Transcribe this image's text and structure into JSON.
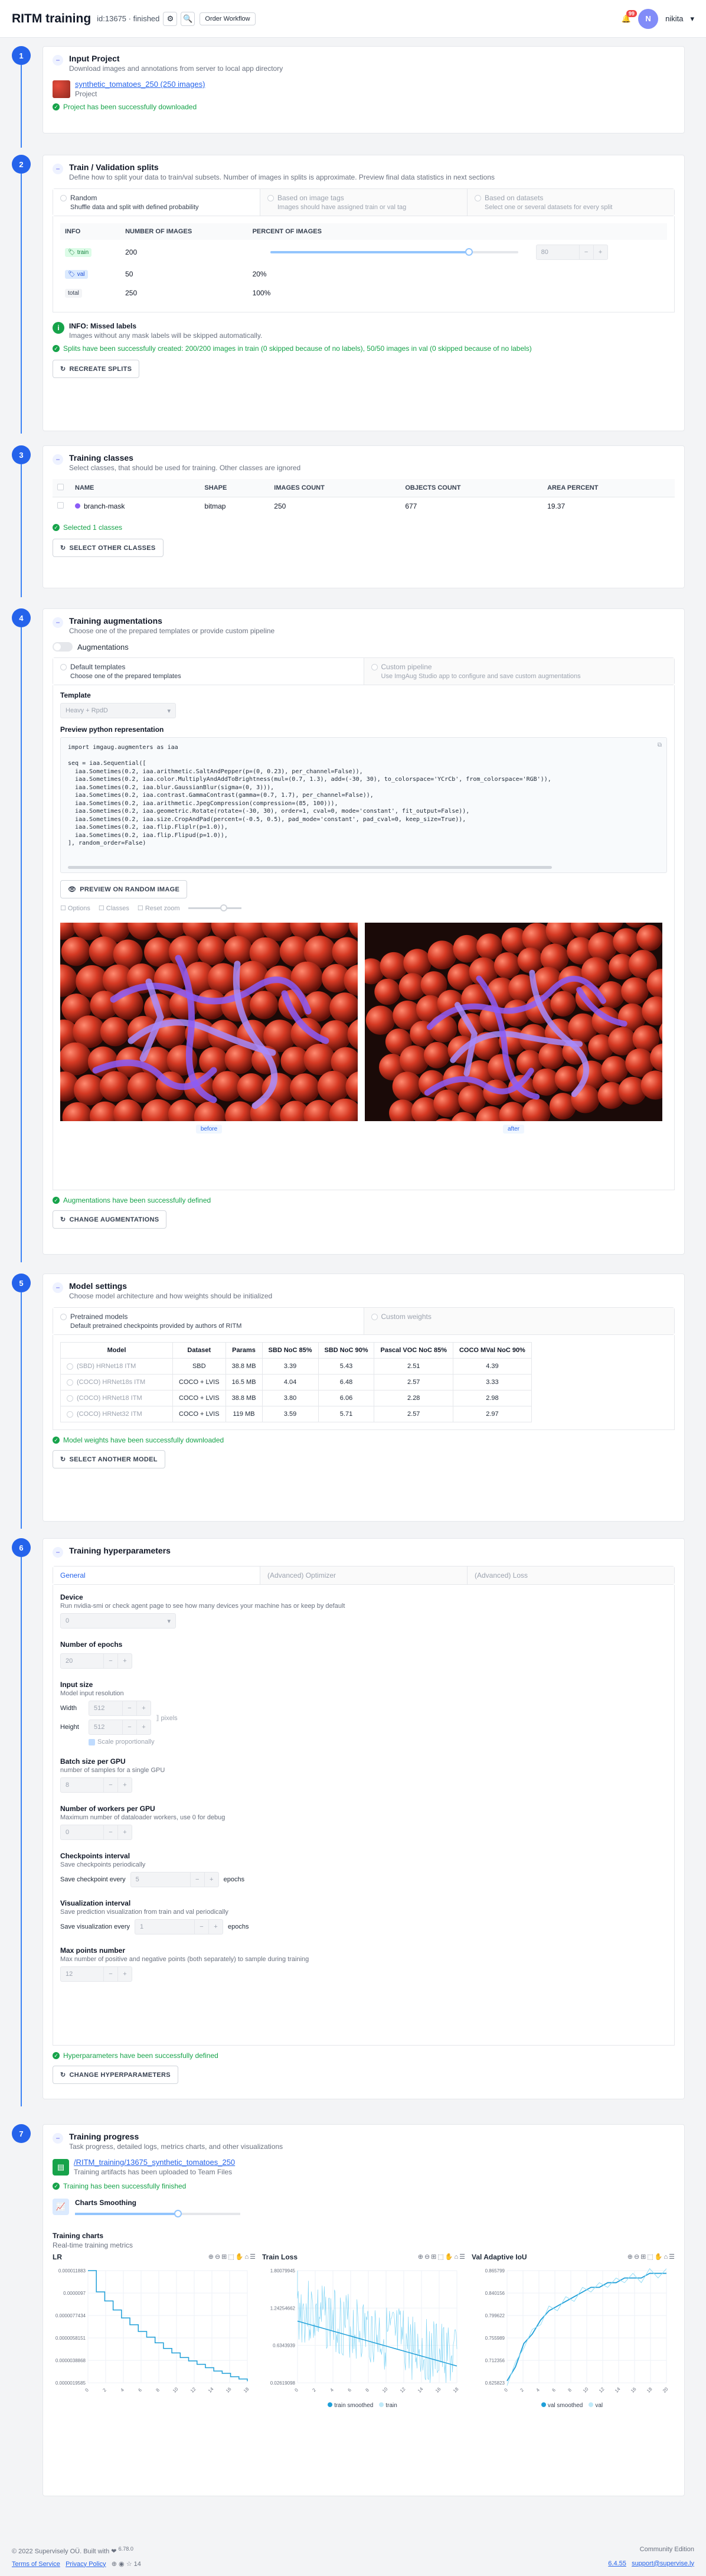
{
  "header": {
    "title": "RITM training",
    "meta": "id:13675 · finished",
    "workflow": "Order Workflow",
    "notifications": "99",
    "user_initial": "N",
    "user": "nikita"
  },
  "s1": {
    "num": "1",
    "title": "Input Project",
    "desc": "Download images and annotations from server to local app directory",
    "project_link": "synthetic_tomatoes_250 (250 images)",
    "project_sub": "Project",
    "ok": "Project has been successfully downloaded"
  },
  "s2": {
    "num": "2",
    "title": "Train / Validation splits",
    "desc": "Define how to split your data to train/val subsets. Number of images in splits is approximate. Preview final data statistics in next sections",
    "tabs": [
      {
        "t": "Random",
        "d": "Shuffle data and split with defined probability"
      },
      {
        "t": "Based on image tags",
        "d": "Images should have assigned train or val tag"
      },
      {
        "t": "Based on datasets",
        "d": "Select one or several datasets for every split"
      }
    ],
    "cols": [
      "INFO",
      "NUMBER OF IMAGES",
      "PERCENT OF IMAGES"
    ],
    "rows": [
      {
        "tag": "train",
        "n": "200",
        "p": "80"
      },
      {
        "tag": "val",
        "n": "50",
        "p": "20%"
      },
      {
        "tag": "total",
        "n": "250",
        "p": "100%"
      }
    ],
    "info_title": "INFO: Missed labels",
    "info_desc": "Images without any mask labels will be skipped automatically.",
    "ok": "Splits have been successfully created: 200/200 images in train (0 skipped because of no labels), 50/50 images in val (0 skipped because of no labels)",
    "btn": "RECREATE SPLITS"
  },
  "s3": {
    "num": "3",
    "title": "Training classes",
    "desc": "Select classes, that should be used for training. Other classes are ignored",
    "cols": [
      "NAME",
      "SHAPE",
      "IMAGES COUNT",
      "OBJECTS COUNT",
      "AREA PERCENT"
    ],
    "row": {
      "name": "branch-mask",
      "shape": "bitmap",
      "images": "250",
      "objects": "677",
      "area": "19.37"
    },
    "ok": "Selected 1 classes",
    "btn": "SELECT OTHER CLASSES"
  },
  "s4": {
    "num": "4",
    "title": "Training augmentations",
    "desc": "Choose one of the prepared templates or provide custom pipeline",
    "toggle": "Augmentations",
    "tabs": [
      {
        "t": "Default templates",
        "d": "Choose one of the prepared templates"
      },
      {
        "t": "Custom pipeline",
        "d": "Use ImgAug Studio app to configure and save custom augmentations"
      }
    ],
    "template_label": "Template",
    "template": "Heavy + RpdD",
    "preview_label": "Preview python representation",
    "code": [
      "import imgaug.augmenters as iaa",
      "",
      "seq = iaa.Sequential([",
      "  iaa.Sometimes(0.2, iaa.arithmetic.SaltAndPepper(p=(0, 0.23), per_channel=False)),",
      "  iaa.Sometimes(0.2, iaa.color.MultiplyAndAddToBrightness(mul=(0.7, 1.3), add=(-30, 30), to_colorspace='YCrCb', from_colorspace='RGB')),",
      "  iaa.Sometimes(0.2, iaa.blur.GaussianBlur(sigma=(0, 3))),",
      "  iaa.Sometimes(0.2, iaa.contrast.GammaContrast(gamma=(0.7, 1.7), per_channel=False)),",
      "  iaa.Sometimes(0.2, iaa.arithmetic.JpegCompression(compression=(85, 100))),",
      "  iaa.Sometimes(0.2, iaa.geometric.Rotate(rotate=(-30, 30), order=1, cval=0, mode='constant', fit_output=False)),",
      "  iaa.Sometimes(0.2, iaa.size.CropAndPad(percent=(-0.5, 0.5), pad_mode='constant', pad_cval=0, keep_size=True)),",
      "  iaa.Sometimes(0.2, iaa.flip.Fliplr(p=1.0)),",
      "  iaa.Sometimes(0.2, iaa.flip.Flipud(p=1.0)),",
      "], random_order=False)"
    ],
    "preview_btn": "PREVIEW ON RANDOM IMAGE",
    "opts": [
      "Options",
      "Classes",
      "Reset zoom"
    ],
    "before": "before",
    "after": "after",
    "ok": "Augmentations have been successfully defined",
    "btn": "CHANGE AUGMENTATIONS"
  },
  "s5": {
    "num": "5",
    "title": "Model settings",
    "desc": "Choose model architecture and how weights should be initialized",
    "tabs": [
      {
        "t": "Pretrained models",
        "d": "Default pretrained checkpoints provided by authors of RITM"
      },
      {
        "t": "Custom weights",
        "d": ""
      }
    ],
    "cols": [
      "Model",
      "Dataset",
      "Params",
      "SBD NoC 85%",
      "SBD NoC 90%",
      "Pascal VOC NoC 85%",
      "COCO MVal NoC 90%"
    ],
    "rows": [
      [
        "(SBD) HRNet18 ITM",
        "SBD",
        "38.8 MB",
        "3.39",
        "5.43",
        "2.51",
        "4.39"
      ],
      [
        "(COCO) HRNet18s ITM",
        "COCO + LVIS",
        "16.5 MB",
        "4.04",
        "6.48",
        "2.57",
        "3.33"
      ],
      [
        "(COCO) HRNet18 ITM",
        "COCO + LVIS",
        "38.8 MB",
        "3.80",
        "6.06",
        "2.28",
        "2.98"
      ],
      [
        "(COCO) HRNet32 ITM",
        "COCO + LVIS",
        "119 MB",
        "3.59",
        "5.71",
        "2.57",
        "2.97"
      ]
    ],
    "ok": "Model weights have been successfully downloaded",
    "btn": "SELECT ANOTHER MODEL"
  },
  "s6": {
    "num": "6",
    "title": "Training hyperparameters",
    "tabs": [
      "General",
      "(Advanced) Optimizer",
      "(Advanced) Loss"
    ],
    "device_l": "Device",
    "device_d": "Run nvidia-smi or check agent page to see how many devices your machine has or keep by default",
    "device_v": "0",
    "epochs_l": "Number of epochs",
    "epochs_v": "20",
    "input_l": "Input size",
    "input_d": "Model input resolution",
    "width_l": "Width",
    "width_v": "512",
    "height_l": "Height",
    "height_v": "512",
    "px": "pixels",
    "scale": "Scale proportionally",
    "batch_l": "Batch size per GPU",
    "batch_d": "number of samples for a single GPU",
    "batch_v": "8",
    "workers_l": "Number of workers per GPU",
    "workers_d": "Maximum number of dataloader workers, use 0 for debug",
    "workers_v": "0",
    "ckpt_l": "Checkpoints interval",
    "ckpt_d": "Save checkpoints periodically",
    "ckpt_pre": "Save checkpoint every",
    "ckpt_v": "5",
    "ckpt_post": "epochs",
    "vis_l": "Visualization interval",
    "vis_d": "Save prediction visualization from train and val periodically",
    "vis_pre": "Save visualization every",
    "vis_v": "1",
    "vis_post": "epochs",
    "pts_l": "Max points number",
    "pts_d": "Max number of positive and negative points (both separately) to sample during training",
    "pts_v": "12",
    "ok": "Hyperparameters have been successfully defined",
    "btn": "CHANGE HYPERPARAMETERS"
  },
  "s7": {
    "num": "7",
    "title": "Training progress",
    "desc": "Task progress, detailed logs, metrics charts, and other visualizations",
    "link": "/RITM_training/13675_synthetic_tomatoes_250",
    "link_sub": "Training artifacts has been uploaded to Team Files",
    "ok": "Training has been successfully finished",
    "smooth": "Charts Smoothing",
    "charts_t": "Training charts",
    "charts_d": "Real-time training metrics"
  },
  "chart_data": [
    {
      "type": "line",
      "title": "LR",
      "x": [
        0,
        1,
        2,
        3,
        4,
        5,
        6,
        7,
        8,
        9,
        10,
        11,
        12,
        13,
        14,
        15,
        16,
        17,
        18,
        19
      ],
      "series": [
        {
          "values": [
            1.1883e-05,
            1e-05,
            9.2e-06,
            8.4e-06,
            7.7e-06,
            7.1e-06,
            6.5e-06,
            6e-06,
            5.5e-06,
            5e-06,
            4.6e-06,
            4.2e-06,
            3.9e-06,
            3.6e-06,
            3.3e-06,
            3e-06,
            2.8e-06,
            2.5e-06,
            2.3e-06,
            2.1e-06
          ]
        }
      ],
      "yticks": [
        "0.000011883",
        "0.0000097",
        "0.0000077434",
        "0.0000058151",
        "0.0000038868",
        "0.0000019585"
      ],
      "xticks": [
        "0",
        "2",
        "4",
        "6",
        "8",
        "10",
        "12",
        "14",
        "16",
        "18"
      ]
    },
    {
      "type": "line",
      "title": "Train Loss",
      "yticks": [
        "1.80079945",
        "1.24254662",
        "0.6343939",
        "0.02619098"
      ],
      "xticks": [
        "0",
        "2",
        "4",
        "6",
        "8",
        "10",
        "12",
        "14",
        "16",
        "18"
      ],
      "series": [
        {
          "name": "train smoothed"
        },
        {
          "name": "train"
        }
      ]
    },
    {
      "type": "line",
      "title": "Val Adaptive IoU",
      "yticks": [
        "0.865799",
        "0.840156",
        "0.799622",
        "0.755989",
        "0.712356",
        "0.625823"
      ],
      "xticks": [
        "0",
        "2",
        "4",
        "6",
        "8",
        "10",
        "12",
        "14",
        "16",
        "18",
        "20"
      ],
      "series": [
        {
          "name": "val smoothed",
          "values": [
            0.63,
            0.66,
            0.71,
            0.73,
            0.76,
            0.78,
            0.79,
            0.8,
            0.81,
            0.82,
            0.83,
            0.83,
            0.84,
            0.84,
            0.85,
            0.85,
            0.85,
            0.86,
            0.86,
            0.86
          ]
        },
        {
          "name": "val"
        }
      ]
    }
  ],
  "footer": {
    "copy": "© 2022 Supervisely OÜ. Built with ❤ ",
    "ver": "6.78.0",
    "edition": "Community Edition",
    "terms": "Terms of Service",
    "privacy": "Privacy Policy",
    "count": "14",
    "build": "6.4.55",
    "email": "support@supervise.ly"
  },
  "colors": {
    "accent": "#2563eb",
    "success": "#16a34a",
    "mask": "#8b5cf6",
    "tomato": "#c0392b"
  }
}
